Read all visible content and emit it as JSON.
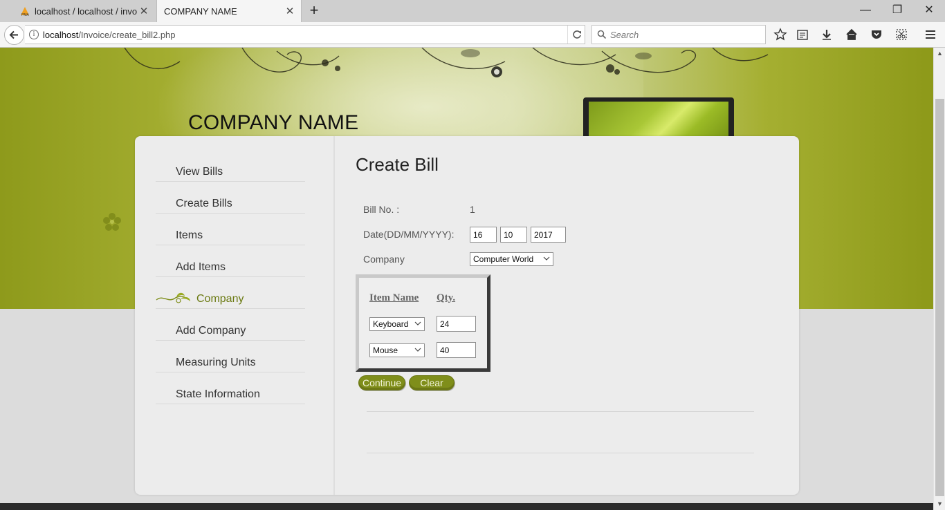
{
  "browser": {
    "tabs": [
      {
        "title": "localhost / localhost / invoic",
        "active": false
      },
      {
        "title": "COMPANY NAME",
        "active": true
      }
    ],
    "url_host": "localhost",
    "url_path": "/Invoice/create_bill2.php",
    "search_placeholder": "Search"
  },
  "header": {
    "company_name": "COMPANY NAME"
  },
  "sidebar": {
    "items": [
      {
        "label": "View Bills"
      },
      {
        "label": "Create Bills"
      },
      {
        "label": "Items"
      },
      {
        "label": "Add Items"
      },
      {
        "label": "Company",
        "current": true
      },
      {
        "label": "Add Company"
      },
      {
        "label": "Measuring Units"
      },
      {
        "label": "State Information"
      }
    ]
  },
  "form": {
    "title": "Create Bill",
    "bill_no_label": "Bill No. :",
    "bill_no_value": "1",
    "date_label": "Date(DD/MM/YYYY):",
    "date_day": "16",
    "date_month": "10",
    "date_year": "2017",
    "company_label": "Company",
    "company_selected": "Computer World",
    "items_table": {
      "headers": [
        "Item Name",
        "Qty."
      ],
      "rows": [
        {
          "item": "Keyboard",
          "qty": "24"
        },
        {
          "item": "Mouse",
          "qty": "40"
        }
      ]
    },
    "continue_label": "Continue",
    "clear_label": "Clear"
  },
  "theme": {
    "accent": "#7f8e1a",
    "banner": "#8e9a1b",
    "panel": "#ececec"
  }
}
